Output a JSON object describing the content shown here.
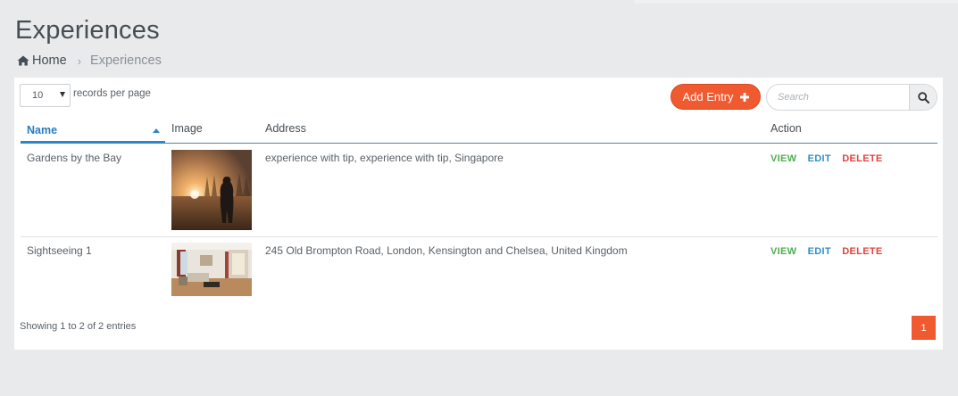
{
  "page": {
    "title": "Experiences"
  },
  "breadcrumb": {
    "home_label": "Home",
    "separator": "›",
    "current": "Experiences"
  },
  "table_controls": {
    "length_value": "10",
    "length_label": "records per page",
    "add_entry_label": "Add Entry",
    "search_placeholder": "Search"
  },
  "columns": {
    "name": "Name",
    "image": "Image",
    "address": "Address",
    "action": "Action"
  },
  "sort": {
    "column": "Name",
    "direction": "ascending"
  },
  "rows": [
    {
      "name": "Gardens by the Bay",
      "image_desc": "sunset-silhouette-photo",
      "address": "experience with tip, experience with tip, Singapore",
      "actions": {
        "view": "VIEW",
        "edit": "EDIT",
        "delete": "DELETE"
      }
    },
    {
      "name": "Sightseeing 1",
      "image_desc": "living-room-photo",
      "address": "245 Old Brompton Road, London, Kensington and Chelsea, United Kingdom",
      "actions": {
        "view": "VIEW",
        "edit": "EDIT",
        "delete": "DELETE"
      }
    }
  ],
  "footer": {
    "info": "Showing 1 to 2 of 2 entries",
    "current_page": "1"
  },
  "colors": {
    "accent": "#f05a30",
    "link_blue": "#2a7bc0",
    "view_green": "#4cae4c",
    "edit_blue": "#2f8fc6",
    "delete_red": "#e1423c"
  }
}
